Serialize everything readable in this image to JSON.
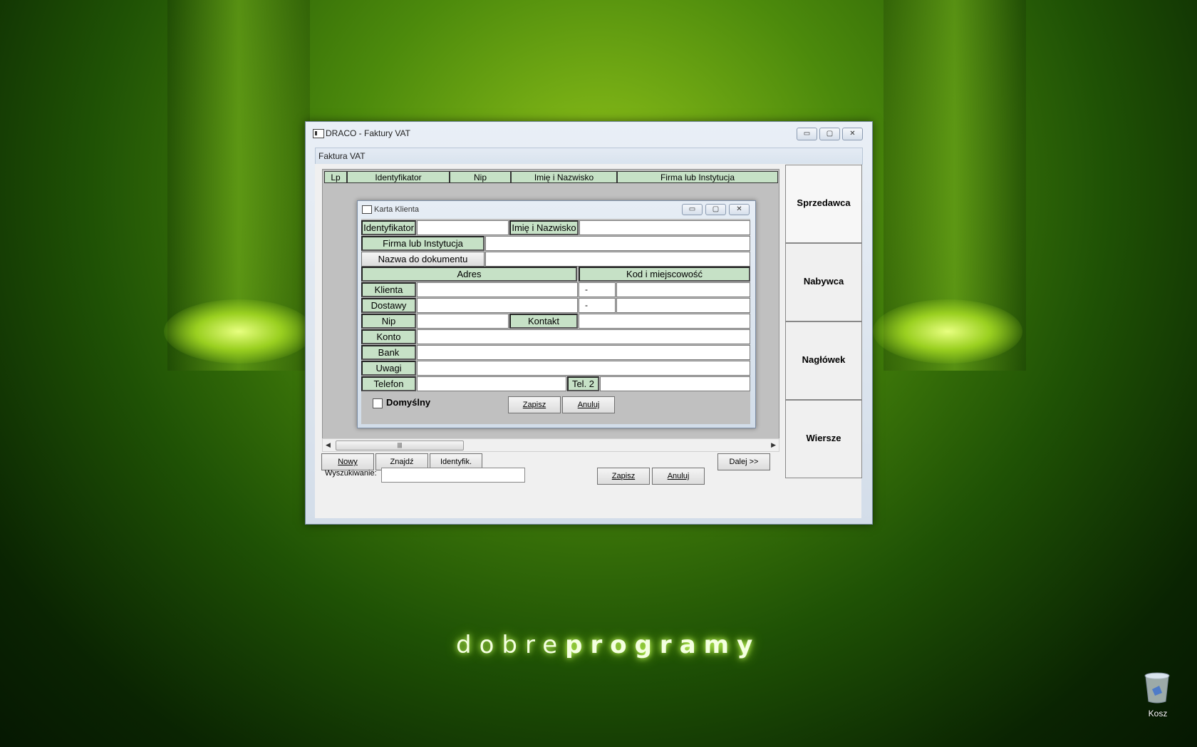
{
  "desktop": {
    "brand_light": "dobre",
    "brand_bold": "programy",
    "recycle_bin_label": "Kosz"
  },
  "main_window": {
    "title": "DRACO - Faktury VAT",
    "controls": {
      "minimize": "▭",
      "maximize": "▢",
      "close": "✕"
    },
    "sub_title": "Faktura VAT",
    "grid_columns": [
      "Lp",
      "Identyfikator",
      "Nip",
      "Imię i Nazwisko",
      "Firma lub Instytucja"
    ],
    "scroll_thumb": "|||",
    "bottom_buttons": {
      "new": "Nowy",
      "find": "Znajdź",
      "ident": "Identyfik.",
      "next": "Dalej >>"
    },
    "tabs": [
      "Sprzedawca",
      "Nabywca",
      "Nagłówek",
      "Wiersze"
    ],
    "search_label": "Wyszukiwanie:",
    "search_value": "",
    "save": "Zapisz",
    "cancel": "Anuluj"
  },
  "dialog": {
    "title": "Karta Klienta",
    "labels": {
      "identifier": "Identyfikator",
      "name": "Imię i Nazwisko",
      "company": "Firma lub Instytucja",
      "doc_name": "Nazwa do dokumentu",
      "address": "Adres",
      "postal": "Kod i miejscowość",
      "client": "Klienta",
      "delivery": "Dostawy",
      "nip": "Nip",
      "contact": "Kontakt",
      "account": "Konto",
      "bank": "Bank",
      "notes": "Uwagi",
      "phone": "Telefon",
      "phone2": "Tel. 2"
    },
    "postal_dash": "-",
    "default_checkbox": "Domyślny",
    "save": "Zapisz",
    "cancel": "Anuluj"
  }
}
